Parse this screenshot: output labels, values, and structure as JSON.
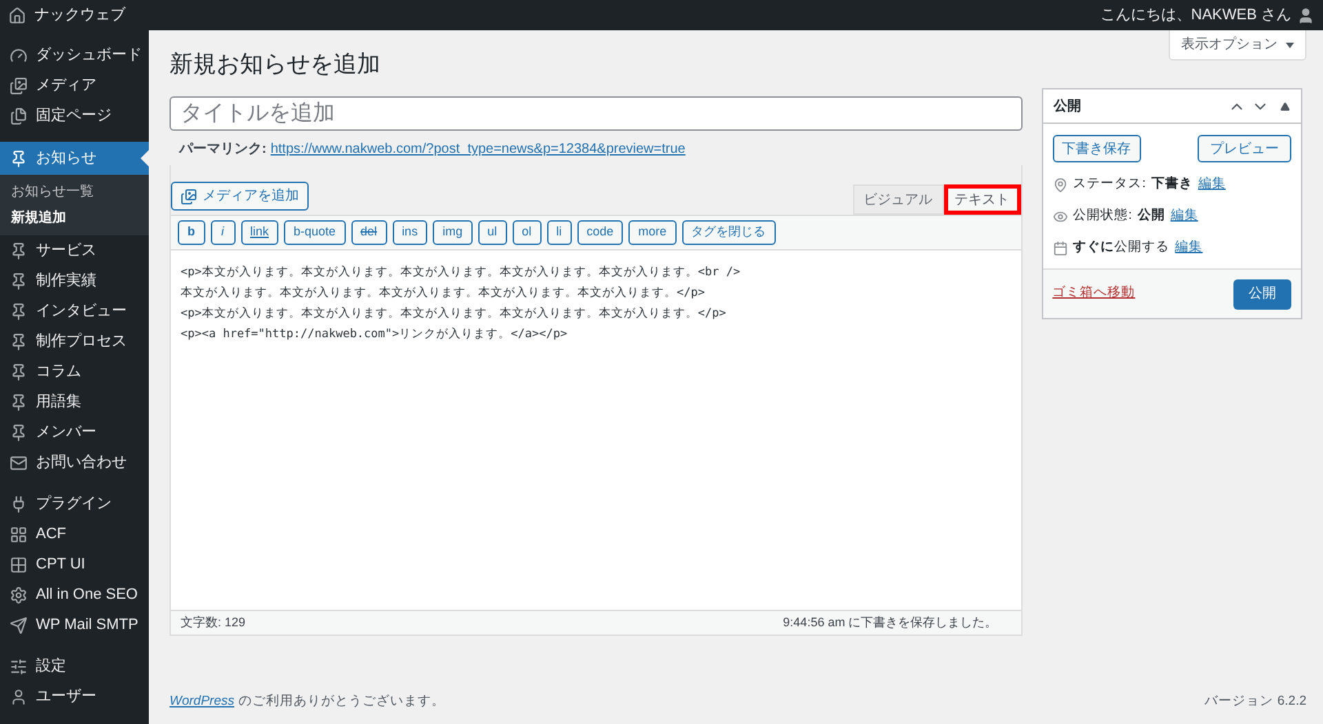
{
  "admin_bar": {
    "site_name": "ナックウェブ",
    "greeting": "こんにちは、NAKWEB さん"
  },
  "sidebar": {
    "groups": [
      [
        {
          "label": "ダッシュボード",
          "selected": false
        },
        {
          "label": "メディア",
          "selected": false
        },
        {
          "label": "固定ページ",
          "selected": false
        }
      ],
      [
        {
          "label": "お知らせ",
          "selected": true,
          "children": [
            {
              "label": "お知らせ一覧",
              "selected": false
            },
            {
              "label": "新規追加",
              "selected": true
            }
          ]
        },
        {
          "label": "サービス",
          "selected": false
        },
        {
          "label": "制作実績",
          "selected": false
        },
        {
          "label": "インタビュー",
          "selected": false
        },
        {
          "label": "制作プロセス",
          "selected": false
        },
        {
          "label": "コラム",
          "selected": false
        },
        {
          "label": "用語集",
          "selected": false
        },
        {
          "label": "メンバー",
          "selected": false
        },
        {
          "label": "お問い合わせ",
          "selected": false
        }
      ],
      [
        {
          "label": "プラグイン",
          "selected": false
        },
        {
          "label": "ACF",
          "selected": false
        },
        {
          "label": "CPT UI",
          "selected": false
        },
        {
          "label": "All in One SEO",
          "selected": false
        },
        {
          "label": "WP Mail SMTP",
          "selected": false
        }
      ],
      [
        {
          "label": "設定",
          "selected": false
        },
        {
          "label": "ユーザー",
          "selected": false
        }
      ]
    ]
  },
  "page_title": "新規お知らせを追加",
  "screen_options": "表示オプション",
  "title_field": {
    "placeholder": "タイトルを追加"
  },
  "permalink": {
    "label": "パーマリンク:",
    "url": "https://www.nakweb.com/?post_type=news&p=12384&preview=true"
  },
  "add_media": "メディアを追加",
  "editor_tabs": [
    {
      "label": "ビジュアル",
      "selected": false,
      "highlighted": false
    },
    {
      "label": "テキスト",
      "selected": true,
      "highlighted": true
    }
  ],
  "quicktags": [
    {
      "label": "b",
      "kind": "bold"
    },
    {
      "label": "i",
      "kind": "italic"
    },
    {
      "label": "link",
      "kind": "link"
    },
    {
      "label": "b-quote",
      "kind": "plain"
    },
    {
      "label": "del",
      "kind": "strike"
    },
    {
      "label": "ins",
      "kind": "plain"
    },
    {
      "label": "img",
      "kind": "plain"
    },
    {
      "label": "ul",
      "kind": "plain"
    },
    {
      "label": "ol",
      "kind": "plain"
    },
    {
      "label": "li",
      "kind": "plain"
    },
    {
      "label": "code",
      "kind": "plain"
    },
    {
      "label": "more",
      "kind": "plain"
    },
    {
      "label": "タグを閉じる",
      "kind": "plain"
    }
  ],
  "content_lines": [
    "<p>本文が入ります。本文が入ります。本文が入ります。本文が入ります。本文が入ります。<br />",
    "本文が入ります。本文が入ります。本文が入ります。本文が入ります。本文が入ります。</p>",
    "<p>本文が入ります。本文が入ります。本文が入ります。本文が入ります。本文が入ります。</p>",
    "<p><a href=\"http://nakweb.com\">リンクが入ります。</a></p>"
  ],
  "status_bar": {
    "word_count": "文字数: 129",
    "autosave": "9:44:56 am に下書きを保存しました。"
  },
  "publish_box": {
    "title": "公開",
    "save_draft": "下書き保存",
    "preview": "プレビュー",
    "rows": [
      {
        "label": "ステータス:",
        "value": "下書き",
        "link": "編集"
      },
      {
        "label": "公開状態:",
        "value": "公開",
        "link": "編集"
      },
      {
        "label": "**すぐに**公開する",
        "link": "編集"
      }
    ],
    "trash": "ゴミ箱へ移動",
    "publish": "公開"
  },
  "footer": {
    "link": "WordPress",
    "text": "のご利用ありがとうございます。",
    "version": "バージョン 6.2.2"
  }
}
